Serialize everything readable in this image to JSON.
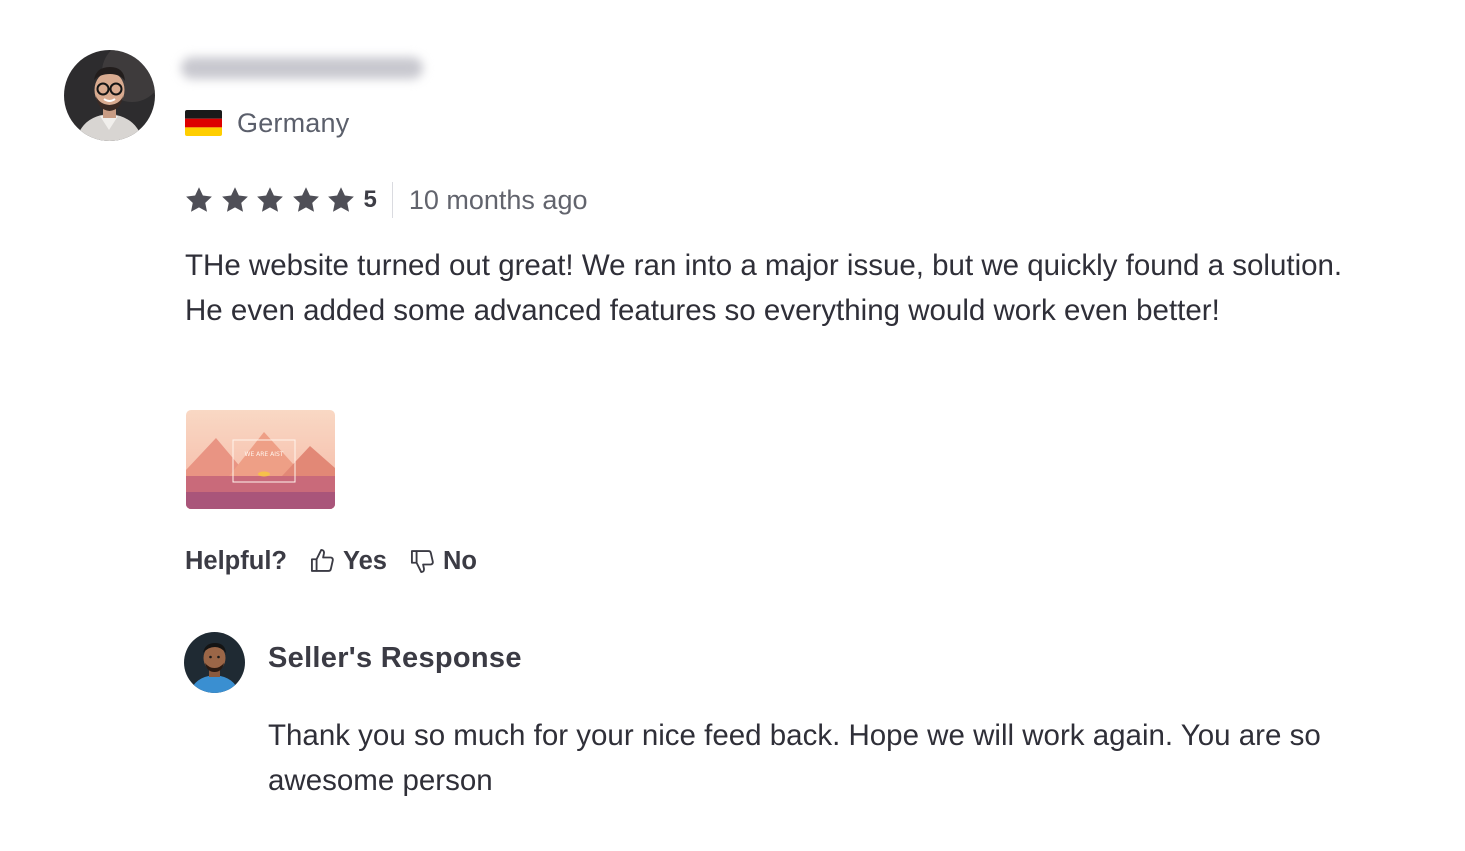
{
  "review": {
    "country": "Germany",
    "rating": {
      "stars": 5,
      "value_label": "5"
    },
    "time_ago": "10 months ago",
    "text": "THe website turned out great! We ran into a major issue, but we quickly found a solution. He even added some advanced features so everything would work even better!",
    "attachment": {
      "caption": "WE ARE AIST"
    },
    "helpful": {
      "label": "Helpful?",
      "yes_label": "Yes",
      "no_label": "No"
    }
  },
  "seller_response": {
    "title": "Seller's Response",
    "text": "Thank you so much for your nice feed back. Hope we will work again. You are so awesome person"
  },
  "colors": {
    "star": "#4f4f57",
    "text": "#2f2f38",
    "muted_text": "#62646d",
    "flag_black": "#1a1a1a",
    "flag_red": "#dd0000",
    "flag_gold": "#ffce00"
  }
}
